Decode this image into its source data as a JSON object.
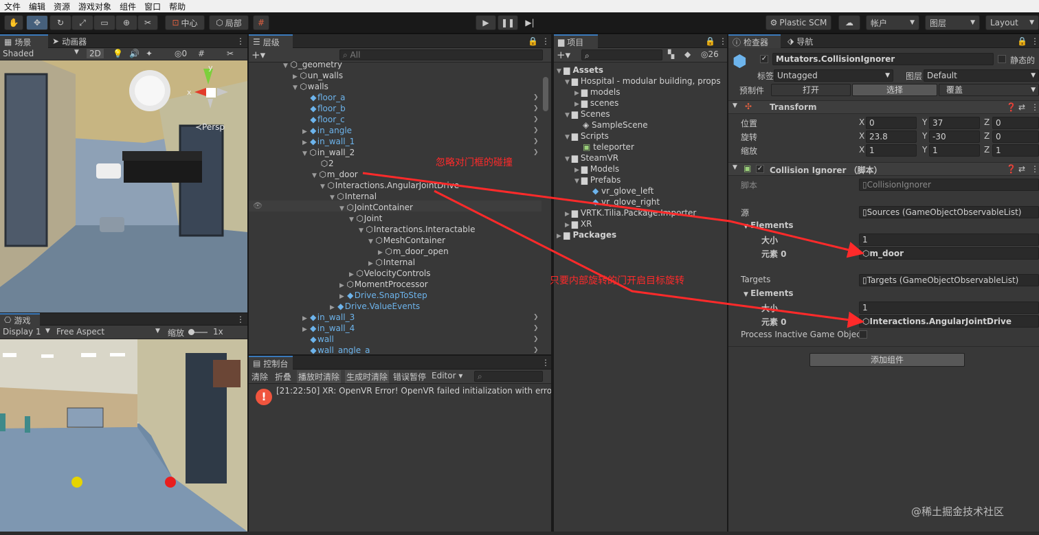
{
  "menu": [
    "文件",
    "编辑",
    "资源",
    "游戏对象",
    "组件",
    "窗口",
    "帮助"
  ],
  "toolbar": {
    "pivot": "中心",
    "space": "局部",
    "plastic": "Plastic SCM",
    "account": "帐户",
    "layers": "图层",
    "layout": "Layout"
  },
  "scene": {
    "tab1": "场景",
    "tab2": "动画器",
    "shading": "Shaded",
    "mode2d": "2D",
    "hidden_count": "0",
    "persp": "≺Persp",
    "gizmo_y": "y",
    "gizmo_x": "x"
  },
  "game": {
    "tab": "游戏",
    "display": "Display 1",
    "aspect": "Free Aspect",
    "scale_label": "缩放",
    "scale_value": "1x"
  },
  "hierarchy": {
    "tab": "层级",
    "search_placeholder": "All",
    "items": [
      {
        "label": "_geometry",
        "blue": false
      },
      {
        "label": "un_walls",
        "blue": false
      },
      {
        "label": "walls",
        "blue": false
      },
      {
        "label": "floor_a",
        "blue": true
      },
      {
        "label": "floor_b",
        "blue": true
      },
      {
        "label": "floor_c",
        "blue": true
      },
      {
        "label": "in_angle",
        "blue": true
      },
      {
        "label": "in_wall_1",
        "blue": true
      },
      {
        "label": "in_wall_2",
        "blue": false
      },
      {
        "label": "2",
        "blue": false
      },
      {
        "label": "m_door",
        "blue": false
      },
      {
        "label": "Interactions.AngularJointDrive",
        "blue": false
      },
      {
        "label": "Internal",
        "blue": false
      },
      {
        "label": "JointContainer",
        "blue": false
      },
      {
        "label": "Joint",
        "blue": false
      },
      {
        "label": "Interactions.Interactable",
        "blue": false
      },
      {
        "label": "MeshContainer",
        "blue": false
      },
      {
        "label": "m_door_open",
        "blue": false
      },
      {
        "label": "Internal",
        "blue": false
      },
      {
        "label": "VelocityControls",
        "blue": false
      },
      {
        "label": "MomentProcessor",
        "blue": false
      },
      {
        "label": "Drive.SnapToStep",
        "blue": true
      },
      {
        "label": "Drive.ValueEvents",
        "blue": true
      },
      {
        "label": "in_wall_3",
        "blue": true
      },
      {
        "label": "in_wall_4",
        "blue": true
      },
      {
        "label": "wall",
        "blue": true
      },
      {
        "label": "wall_angle_a",
        "blue": true
      }
    ]
  },
  "console": {
    "tab": "控制台",
    "buttons": [
      "清除",
      "折叠",
      "播放时清除",
      "生成时清除",
      "错误暂停",
      "Editor ▾"
    ],
    "message": "[21:22:50] XR: OpenVR Error! OpenVR failed initialization with error c"
  },
  "project": {
    "tab": "项目",
    "hidden_count": "26",
    "items": [
      {
        "label": "Assets",
        "bold": true
      },
      {
        "label": "Hospital - modular building, props",
        "bold": false
      },
      {
        "label": "models",
        "bold": false
      },
      {
        "label": "scenes",
        "bold": false
      },
      {
        "label": "Scenes",
        "bold": false
      },
      {
        "label": "SampleScene",
        "bold": false
      },
      {
        "label": "Scripts",
        "bold": false
      },
      {
        "label": "teleporter",
        "bold": false
      },
      {
        "label": "SteamVR",
        "bold": false
      },
      {
        "label": "Models",
        "bold": false
      },
      {
        "label": "Prefabs",
        "bold": false
      },
      {
        "label": "vr_glove_left",
        "bold": false
      },
      {
        "label": "vr_glove_right",
        "bold": false
      },
      {
        "label": "VRTK.Tilia.Package.Importer",
        "bold": false
      },
      {
        "label": "XR",
        "bold": false
      },
      {
        "label": "Packages",
        "bold": true
      }
    ]
  },
  "inspector": {
    "tab1": "检查器",
    "tab2": "导航",
    "object_name": "Mutators.CollisionIgnorer",
    "static_label": "静态的",
    "tag_label": "标签",
    "tag_value": "Untagged",
    "layer_label": "图层",
    "layer_value": "Default",
    "prefab_label": "预制件",
    "prefab_open": "打开",
    "prefab_select": "选择",
    "prefab_override": "覆盖",
    "transform": {
      "title": "Transform",
      "position_label": "位置",
      "rotation_label": "旋转",
      "scale_label": "缩放",
      "position": [
        "0",
        "37",
        "0"
      ],
      "rotation": [
        "23.8",
        "-30",
        "0"
      ],
      "scale": [
        "1",
        "1",
        "1"
      ]
    },
    "component": {
      "title": "Collision Ignorer （脚本）",
      "script_label": "脚本",
      "script_value": "CollisionIgnorer",
      "sources_label": "源",
      "sources_value": "Sources (GameObjectObservableList)",
      "elements_label": "Elements",
      "size_label": "大小",
      "size_value": "1",
      "element0_label": "元素 0",
      "sources_element0": "m_door",
      "targets_label": "Targets",
      "targets_value": "Targets (GameObjectObservableList)",
      "targets_size_value": "1",
      "targets_element0": "Interactions.AngularJointDrive",
      "process_inactive": "Process Inactive Game Objec"
    },
    "add_component": "添加组件"
  },
  "annotations": {
    "note1": "忽略对门框的碰撞",
    "note2": "只要内部旋转的门开启目标旋转"
  },
  "watermark": "@稀土掘金技术社区",
  "colors": {
    "accent": "#3a79bb",
    "annotation": "#ff2a2a",
    "prefab_blue": "#6db4ec"
  }
}
